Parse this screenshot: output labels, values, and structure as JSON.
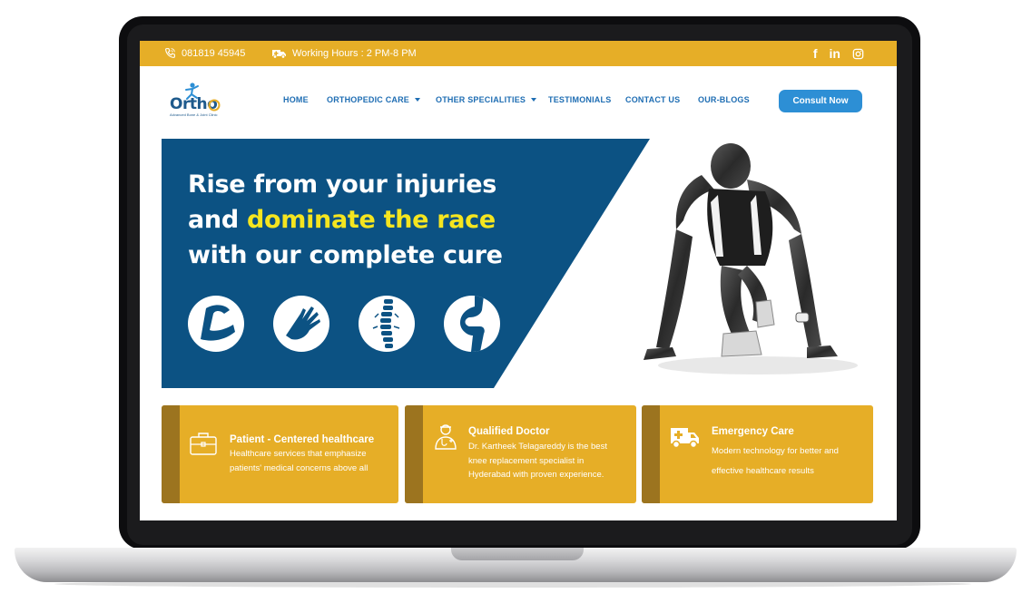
{
  "topbar": {
    "phone": "081819 45945",
    "hours": "Working Hours : 2 PM-8 PM",
    "social": {
      "facebook": "f",
      "linkedin": "in"
    }
  },
  "logo": {
    "text": "Ortho",
    "tagline": "Advanced Bone & Joint Clinic"
  },
  "nav": {
    "home": "HOME",
    "ortho": "ORTHOPEDIC CARE",
    "other": "OTHER SPECIALITIES",
    "testimonials": "TESTIMONIALS",
    "contact": "CONTACT US",
    "blogs": "OUR-BLOGS",
    "consult": "Consult Now"
  },
  "hero": {
    "line1": "Rise from your injuries",
    "line2a": "and ",
    "line2b": "dominate the race",
    "line3": "with our complete cure"
  },
  "cards": [
    {
      "title": "Patient - Centered healthcare",
      "desc": "Healthcare services that emphasize patients' medical concerns above all"
    },
    {
      "title": "Qualified Doctor",
      "desc": "Dr. Kartheek Telagareddy is the best knee replacement specialist in Hyderabad with proven experience."
    },
    {
      "title": "Emergency Care",
      "desc": "Modern technology for better and effective healthcare results"
    }
  ],
  "colors": {
    "accent": "#e6ae27",
    "brand_blue": "#0c5283",
    "button": "#2d8fd5",
    "highlight": "#f5e51f"
  }
}
